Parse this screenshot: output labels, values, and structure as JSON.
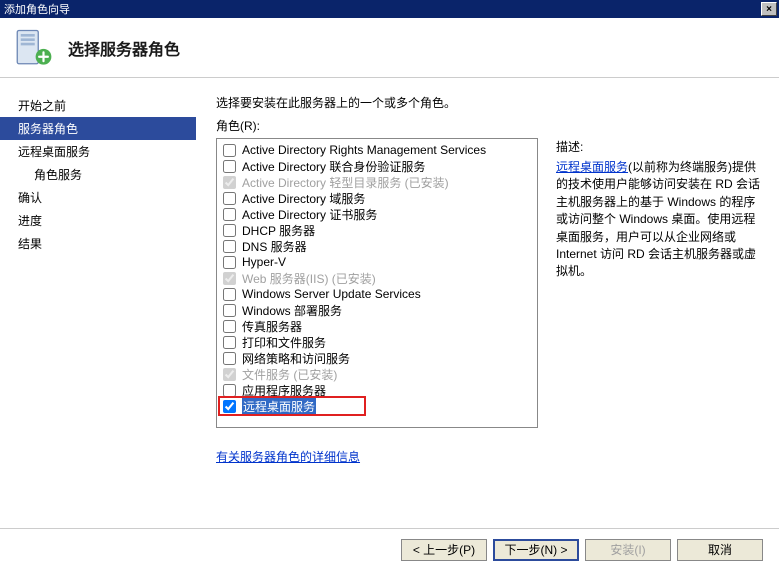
{
  "window": {
    "title": "添加角色向导",
    "close_icon": "×"
  },
  "header": {
    "title": "选择服务器角色"
  },
  "sidebar": {
    "items": [
      {
        "label": "开始之前",
        "selected": false,
        "indent": false
      },
      {
        "label": "服务器角色",
        "selected": true,
        "indent": false
      },
      {
        "label": "远程桌面服务",
        "selected": false,
        "indent": false
      },
      {
        "label": "角色服务",
        "selected": false,
        "indent": true
      },
      {
        "label": "确认",
        "selected": false,
        "indent": false
      },
      {
        "label": "进度",
        "selected": false,
        "indent": false
      },
      {
        "label": "结果",
        "selected": false,
        "indent": false
      }
    ]
  },
  "main": {
    "instruction": "选择要安装在此服务器上的一个或多个角色。",
    "roles_label": "角色(R):",
    "roles": [
      {
        "label": "Active Directory Rights Management Services",
        "checked": false,
        "disabled": false
      },
      {
        "label": "Active Directory 联合身份验证服务",
        "checked": false,
        "disabled": false
      },
      {
        "label": "Active Directory 轻型目录服务  (已安装)",
        "checked": true,
        "disabled": true
      },
      {
        "label": "Active Directory 域服务",
        "checked": false,
        "disabled": false
      },
      {
        "label": "Active Directory 证书服务",
        "checked": false,
        "disabled": false
      },
      {
        "label": "DHCP 服务器",
        "checked": false,
        "disabled": false
      },
      {
        "label": "DNS 服务器",
        "checked": false,
        "disabled": false
      },
      {
        "label": "Hyper-V",
        "checked": false,
        "disabled": false
      },
      {
        "label": "Web 服务器(IIS)  (已安装)",
        "checked": true,
        "disabled": true
      },
      {
        "label": "Windows Server Update Services",
        "checked": false,
        "disabled": false
      },
      {
        "label": "Windows 部署服务",
        "checked": false,
        "disabled": false
      },
      {
        "label": "传真服务器",
        "checked": false,
        "disabled": false
      },
      {
        "label": "打印和文件服务",
        "checked": false,
        "disabled": false
      },
      {
        "label": "网络策略和访问服务",
        "checked": false,
        "disabled": false
      },
      {
        "label": "文件服务  (已安装)",
        "checked": true,
        "disabled": true
      },
      {
        "label": "应用程序服务器",
        "checked": false,
        "disabled": false
      },
      {
        "label": "远程桌面服务",
        "checked": true,
        "disabled": false,
        "highlighted": true
      }
    ],
    "more_link": "有关服务器角色的详细信息"
  },
  "description": {
    "label": "描述:",
    "link_text": "远程桌面服务",
    "text": "(以前称为终端服务)提供的技术使用户能够访问安装在 RD 会话主机服务器上的基于 Windows 的程序或访问整个 Windows 桌面。使用远程桌面服务，用户可以从企业网络或 Internet 访问 RD 会话主机服务器或虚拟机。"
  },
  "footer": {
    "prev": "< 上一步(P)",
    "next": "下一步(N) >",
    "install": "安装(I)",
    "cancel": "取消"
  }
}
